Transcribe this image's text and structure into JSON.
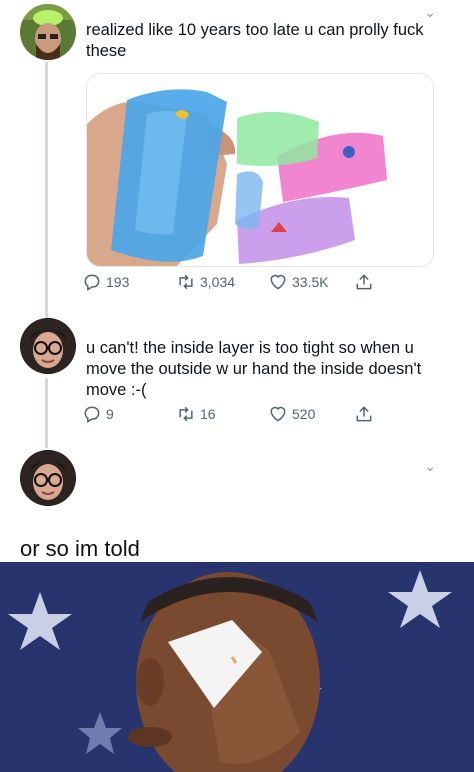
{
  "tweets": [
    {
      "text": "realized like 10 years too late u can prolly fuck these",
      "replies": "193",
      "retweets": "3,034",
      "likes": "33.5K"
    },
    {
      "text": "u can't! the inside layer is too tight so when u move the outside w ur hand the inside doesn't move :-(",
      "replies": "9",
      "retweets": "16",
      "likes": "520"
    }
  ],
  "caption": "or so im told",
  "icons": {
    "reply": "reply-icon",
    "retweet": "retweet-icon",
    "like": "heart-icon",
    "share": "share-icon",
    "menu": "chevron-down-icon"
  },
  "colors": {
    "text": "#0f1419",
    "muted": "#536471",
    "thread_line": "#cfd9de",
    "photo_bg": "#2a3a78"
  }
}
